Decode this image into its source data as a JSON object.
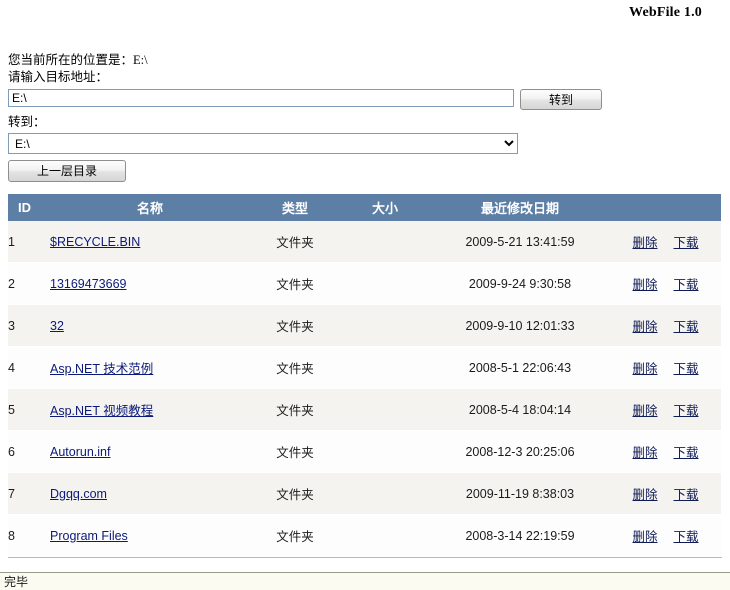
{
  "header": {
    "app_title": "WebFile 1.0"
  },
  "nav": {
    "current_location_label": "您当前所在的位置是：",
    "current_location_value": "E:\\",
    "address_prompt": "请输入目标地址：",
    "address_input_value": "E:\\",
    "address_input_placeholder": "",
    "go_button_label": "转到",
    "goto_label": "转到：",
    "drive_selected": "E:\\",
    "drive_options": [
      "E:\\"
    ],
    "parent_dir_button_label": "上一层目录"
  },
  "table": {
    "columns": [
      "ID",
      "名称",
      "类型",
      "大小",
      "最近修改日期",
      ""
    ],
    "rows": [
      {
        "id": "1",
        "name": "$RECYCLE.BIN",
        "type": "文件夹",
        "size": "",
        "date": "2009-5-21 13:41:59",
        "delete": "删除",
        "download": "下载"
      },
      {
        "id": "2",
        "name": "13169473669",
        "type": "文件夹",
        "size": "",
        "date": "2009-9-24 9:30:58",
        "delete": "删除",
        "download": "下载"
      },
      {
        "id": "3",
        "name": "32",
        "type": "文件夹",
        "size": "",
        "date": "2009-9-10 12:01:33",
        "delete": "删除",
        "download": "下载"
      },
      {
        "id": "4",
        "name": "Asp.NET 技术范例",
        "type": "文件夹",
        "size": "",
        "date": "2008-5-1 22:06:43",
        "delete": "删除",
        "download": "下载"
      },
      {
        "id": "5",
        "name": "Asp.NET 视频教程",
        "type": "文件夹",
        "size": "",
        "date": "2008-5-4 18:04:14",
        "delete": "删除",
        "download": "下载"
      },
      {
        "id": "6",
        "name": "Autorun.inf",
        "type": "文件夹",
        "size": "",
        "date": "2008-12-3 20:25:06",
        "delete": "删除",
        "download": "下载"
      },
      {
        "id": "7",
        "name": "Dgqq.com",
        "type": "文件夹",
        "size": "",
        "date": "2009-11-19 8:38:03",
        "delete": "删除",
        "download": "下载"
      },
      {
        "id": "8",
        "name": "Program Files",
        "type": "文件夹",
        "size": "",
        "date": "2008-3-14 22:19:59",
        "delete": "删除",
        "download": "下载"
      }
    ]
  },
  "status_bar": {
    "text": "完毕"
  },
  "colors": {
    "table_header_bg": "#5d7fa5",
    "row_odd_bg": "#f4f3ef",
    "row_even_bg": "#fdfdfd",
    "link": "#0b1a7a",
    "status_bar_bg": "#fbfbf2"
  }
}
